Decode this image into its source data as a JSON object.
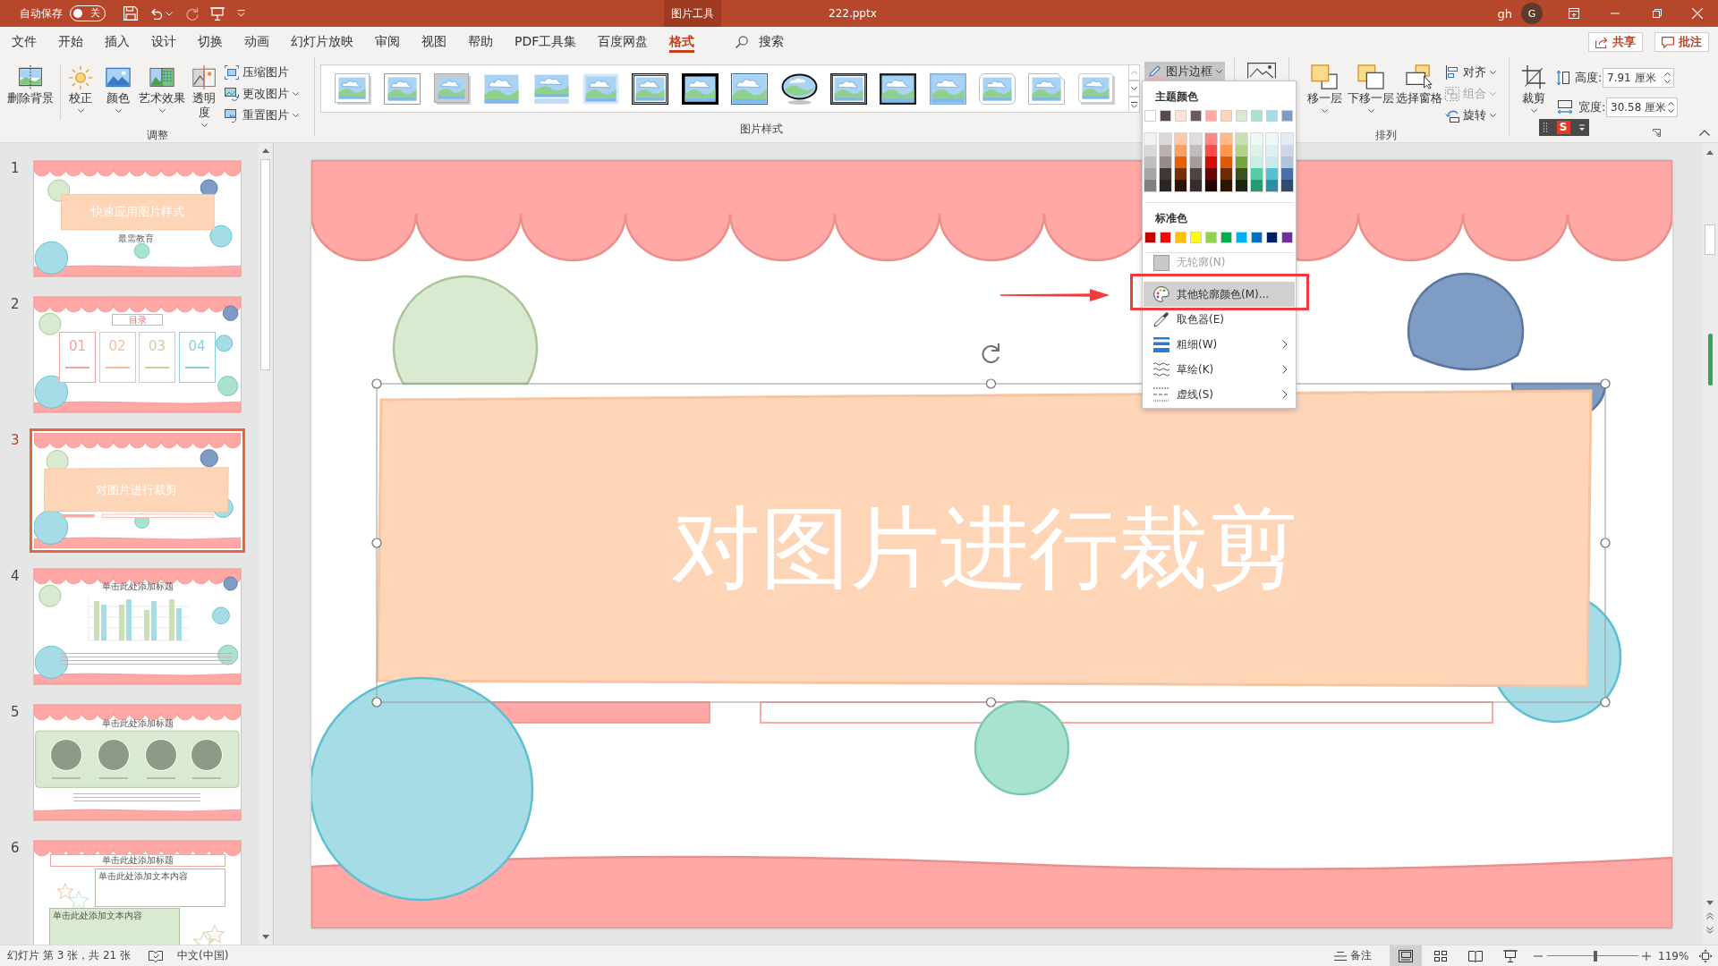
{
  "title_bar": {
    "autosave_label": "自动保存",
    "autosave": {
      "on": false,
      "label": "关"
    },
    "context_tab": "图片工具",
    "file_name": "222.pptx",
    "user": "gh",
    "avatar": "G"
  },
  "tabs": [
    {
      "label": "文件",
      "selected": false
    },
    {
      "label": "开始",
      "selected": false
    },
    {
      "label": "插入",
      "selected": false
    },
    {
      "label": "设计",
      "selected": false
    },
    {
      "label": "切换",
      "selected": false
    },
    {
      "label": "动画",
      "selected": false
    },
    {
      "label": "幻灯片放映",
      "selected": false
    },
    {
      "label": "审阅",
      "selected": false
    },
    {
      "label": "视图",
      "selected": false
    },
    {
      "label": "帮助",
      "selected": false
    },
    {
      "label": "PDF工具集",
      "selected": false
    },
    {
      "label": "百度网盘",
      "selected": false
    },
    {
      "label": "格式",
      "selected": true
    }
  ],
  "search": {
    "label": "搜索"
  },
  "share_button": "共享",
  "comments_button": "批注",
  "ribbon": {
    "adjust": {
      "label": "调整",
      "large_buttons": [
        {
          "kind": "remove_background",
          "label": "删除背景",
          "dropdown": false
        },
        {
          "kind": "corrections",
          "label": "校正",
          "dropdown": true
        },
        {
          "kind": "color",
          "label": "颜色",
          "dropdown": true
        },
        {
          "kind": "artistic",
          "label": "艺术效果",
          "dropdown": true
        },
        {
          "kind": "transparency",
          "label": "透明度",
          "dropdown": true
        }
      ],
      "small_buttons": [
        {
          "kind": "compress",
          "label": "压缩图片",
          "dropdown": false
        },
        {
          "kind": "change",
          "label": "更改图片",
          "dropdown": true
        },
        {
          "kind": "reset",
          "label": "重置图片",
          "dropdown": true
        }
      ]
    },
    "picture_styles": {
      "label": "图片样式"
    },
    "picture_border": {
      "label": "图片边框",
      "expanded": true
    },
    "arrange": {
      "label": "排列",
      "large_buttons": [
        {
          "kind": "bring_forward",
          "label": "移一层",
          "dropdown": true
        },
        {
          "kind": "send_backward",
          "label": "下移一层",
          "dropdown": true
        },
        {
          "kind": "selection_pane",
          "label": "选择窗格",
          "dropdown": false
        }
      ],
      "small_buttons": [
        {
          "kind": "align",
          "label": "对齐",
          "disabled": false
        },
        {
          "kind": "group",
          "label": "组合",
          "disabled": true
        },
        {
          "kind": "rotate",
          "label": "旋转",
          "disabled": false
        }
      ]
    },
    "size": {
      "crop": "裁剪",
      "height": {
        "label": "高度:",
        "value": "7.91 厘米"
      },
      "width": {
        "label": "宽度:",
        "value": "30.58 厘米"
      }
    }
  },
  "ime_toolbar": {
    "logo": "S"
  },
  "border_menu": {
    "theme_header": "主题颜色",
    "theme_colors": [
      {
        "color": "#ffffff"
      },
      {
        "color": "#584a4a"
      },
      {
        "color": "#fde4d8"
      },
      {
        "color": "#6b5a5a"
      },
      {
        "color": "#ffa8a6"
      },
      {
        "color": "#ffd5b8"
      },
      {
        "color": "#d9ead0"
      },
      {
        "color": "#a8e2d0"
      },
      {
        "color": "#a6dce6"
      },
      {
        "color": "#7f9cc4"
      }
    ],
    "theme_shades": [
      [
        {
          "color": "#f2f2f2"
        },
        {
          "color": "#d9d9d9"
        },
        {
          "color": "#bfbfbf"
        },
        {
          "color": "#a6a6a6"
        },
        {
          "color": "#808080"
        }
      ],
      [
        {
          "color": "#dcd8d8"
        },
        {
          "color": "#bab0b0"
        },
        {
          "color": "#988a8a"
        },
        {
          "color": "#423737"
        },
        {
          "color": "#2c2525"
        }
      ],
      [
        {
          "color": "#fdcaa7"
        },
        {
          "color": "#fb9f63"
        },
        {
          "color": "#e85f05"
        },
        {
          "color": "#743002"
        },
        {
          "color": "#2b1404"
        }
      ],
      [
        {
          "color": "#e1dddd"
        },
        {
          "color": "#c4bcbc"
        },
        {
          "color": "#a69b9b"
        },
        {
          "color": "#504343"
        },
        {
          "color": "#352d2d"
        }
      ],
      [
        {
          "color": "#ff8683"
        },
        {
          "color": "#ff4c48"
        },
        {
          "color": "#d40d08"
        },
        {
          "color": "#6a0604"
        },
        {
          "color": "#250101"
        }
      ],
      [
        {
          "color": "#ffb98b"
        },
        {
          "color": "#ff954f"
        },
        {
          "color": "#dc5b08"
        },
        {
          "color": "#6b2c04"
        },
        {
          "color": "#2b1402"
        }
      ],
      [
        {
          "color": "#c8e0b3"
        },
        {
          "color": "#b0d387"
        },
        {
          "color": "#76a63c"
        },
        {
          "color": "#3b531e"
        },
        {
          "color": "#1b260e"
        }
      ],
      [
        {
          "color": "#eef9f6"
        },
        {
          "color": "#dcf3ec"
        },
        {
          "color": "#cbede2"
        },
        {
          "color": "#55cca4"
        },
        {
          "color": "#2a9a72"
        }
      ],
      [
        {
          "color": "#edf8fa"
        },
        {
          "color": "#dbf1f5"
        },
        {
          "color": "#cae9ef"
        },
        {
          "color": "#55c0d0"
        },
        {
          "color": "#2b8f9c"
        }
      ],
      [
        {
          "color": "#e5ebf3"
        },
        {
          "color": "#ccd7e7"
        },
        {
          "color": "#b2c3db"
        },
        {
          "color": "#4a6ea6"
        },
        {
          "color": "#314a70"
        }
      ]
    ],
    "standard_header": "标准色",
    "standard_colors": [
      {
        "color": "#c00000"
      },
      {
        "color": "#ff0000"
      },
      {
        "color": "#ffc000"
      },
      {
        "color": "#ffff00"
      },
      {
        "color": "#92d050"
      },
      {
        "color": "#00b050"
      },
      {
        "color": "#00b0f0"
      },
      {
        "color": "#0070c0"
      },
      {
        "color": "#002060"
      },
      {
        "color": "#7030a0"
      }
    ],
    "items": [
      {
        "kind": "swatch",
        "label": "无轮廓(N)",
        "disabled": true,
        "selected": false,
        "submenu": false
      },
      {
        "kind": "palette",
        "label": "其他轮廓颜色(M)...",
        "disabled": false,
        "selected": true,
        "submenu": false
      },
      {
        "kind": "eyedropper",
        "label": "取色器(E)",
        "disabled": false,
        "selected": false,
        "submenu": false
      },
      {
        "kind": "weight",
        "label": "粗细(W)",
        "disabled": false,
        "selected": false,
        "submenu": true
      },
      {
        "kind": "sketch",
        "label": "草绘(K)",
        "disabled": false,
        "selected": false,
        "submenu": true
      },
      {
        "kind": "dash",
        "label": "虚线(S)",
        "disabled": false,
        "selected": false,
        "submenu": true
      }
    ]
  },
  "slides": [
    {
      "number": "1",
      "selected": false,
      "kind": "title",
      "title": "快速应用图片样式",
      "subtitle": "最需教育"
    },
    {
      "number": "2",
      "selected": false,
      "kind": "contents",
      "title": "目录",
      "items": [
        {
          "number": "01",
          "color": "#f4a3a0"
        },
        {
          "number": "02",
          "color": "#f9bf9a"
        },
        {
          "number": "03",
          "color": "#bcd9a0"
        },
        {
          "number": "04",
          "color": "#8fd0de"
        }
      ]
    },
    {
      "number": "3",
      "selected": true,
      "kind": "crop",
      "title": "对图片进行裁剪"
    },
    {
      "number": "4",
      "selected": false,
      "kind": "chart",
      "title": "单击此处添加标题"
    },
    {
      "number": "5",
      "selected": false,
      "kind": "photos",
      "title": "单击此处添加标题"
    },
    {
      "number": "6",
      "selected": false,
      "kind": "text",
      "title": "单击此处添加标题",
      "boxes": [
        "单击此处添加文本内容",
        "单击此处添加文本内容"
      ]
    }
  ],
  "slide": {
    "title": "对图片进行裁剪"
  },
  "status_bar": {
    "slide_info": "幻灯片 第 3 张，共 21 张",
    "language": "中文(中国)",
    "notes": "备注",
    "views": [
      {
        "kind": "normal",
        "selected": true
      },
      {
        "kind": "sorter",
        "selected": false
      },
      {
        "kind": "reading",
        "selected": false
      },
      {
        "kind": "slideshow",
        "selected": false
      }
    ],
    "zoom": {
      "level": 0.53,
      "reading": "119%"
    }
  }
}
